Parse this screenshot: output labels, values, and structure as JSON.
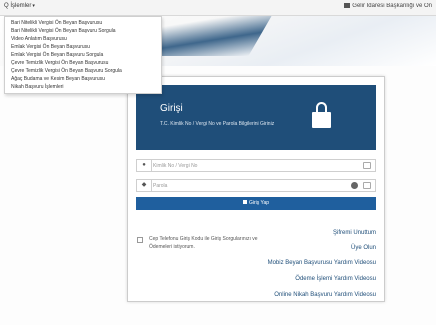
{
  "topbar": {
    "menu_label": "Q İşlemler",
    "menu_caret": "▾",
    "right_link": "Gelir İdaresi Başkanlığı ve On"
  },
  "dropdown": {
    "items": [
      "Bari Nitelikli Vergisi Ön Beyan Başvurusu",
      "Bari Nitelikli Vergisi Ön Beyan Başvuru Sorgula",
      "Video Anlatım Başvurusu",
      "Emlak Vergisi Ön Beyan Başvurusu",
      "Emlak Vergisi Ön Beyan Başvuru Sorgula",
      "Çevre Temizlik Vergisi Ön Beyan Başvurusu",
      "Çevre Temizlik Vergisi Ön Beyan Başvuru Sorgula",
      "Ağaç Budama ve Kesim Beyan Başvurusu",
      "Nikah Başvuru İşlemleri"
    ]
  },
  "panel": {
    "title": "Girişi",
    "subtitle": "T.C. Kimlik No / Vergi No ve Parola Bilgilerini Giriniz",
    "user_placeholder": "Kimlik No / Vergi No",
    "password_placeholder": "Parola",
    "login_label": "Giriş Yap",
    "checkbox_label": "Cep Telefonu Giriş Kodu ile Giriş Sorgularınızı ve Ödemeleri istiyorum.",
    "links": {
      "forgot_password": "Şifremi Unuttum",
      "register": "Üye Olun",
      "video1": "Mobiz Beyan Başvurusu Yardım Videosu",
      "video2": "Ödeme İşlemi Yardım Videosu",
      "video3": "Online Nikah Başvuru Yardım Videosu"
    }
  },
  "colors": {
    "brand": "#1f4e79",
    "button": "#1f5f9e",
    "link": "#1f4e79"
  },
  "icons": [
    "user-icon",
    "lock-icon",
    "eye-icon",
    "keyboard-icon",
    "login-icon"
  ]
}
